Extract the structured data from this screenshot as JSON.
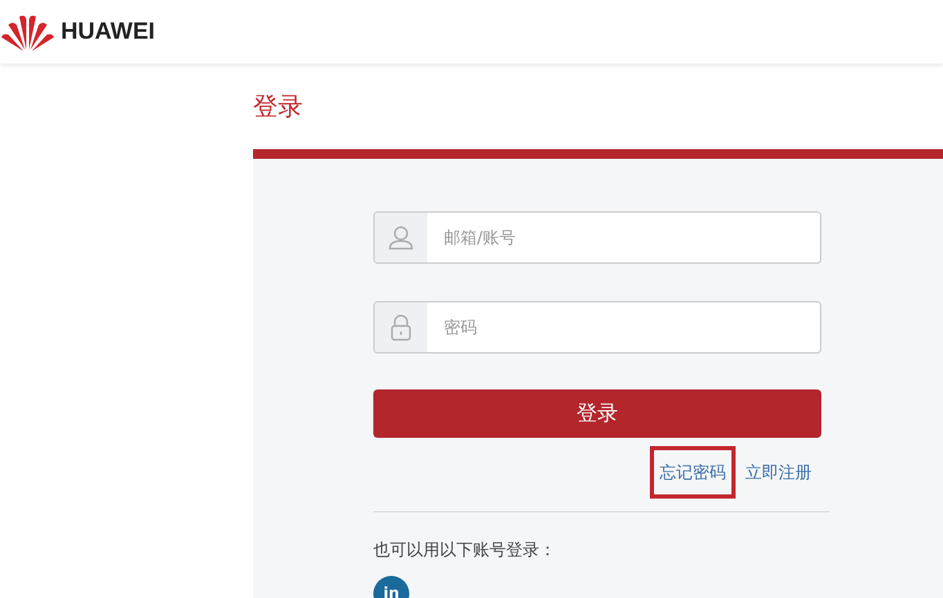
{
  "header": {
    "brand": "HUAWEI"
  },
  "title": "登录",
  "fields": [
    {
      "kind": "user",
      "placeholder": "邮箱/账号"
    },
    {
      "kind": "lock",
      "placeholder": "密码"
    }
  ],
  "submit": "登录",
  "links": [
    {
      "label": "忘记密码",
      "highlighted": true
    },
    {
      "label": "立即注册",
      "highlighted": false
    }
  ],
  "alt_login": {
    "label": "也可以用以下账号登录：",
    "providers": [
      {
        "label": "in"
      }
    ]
  }
}
